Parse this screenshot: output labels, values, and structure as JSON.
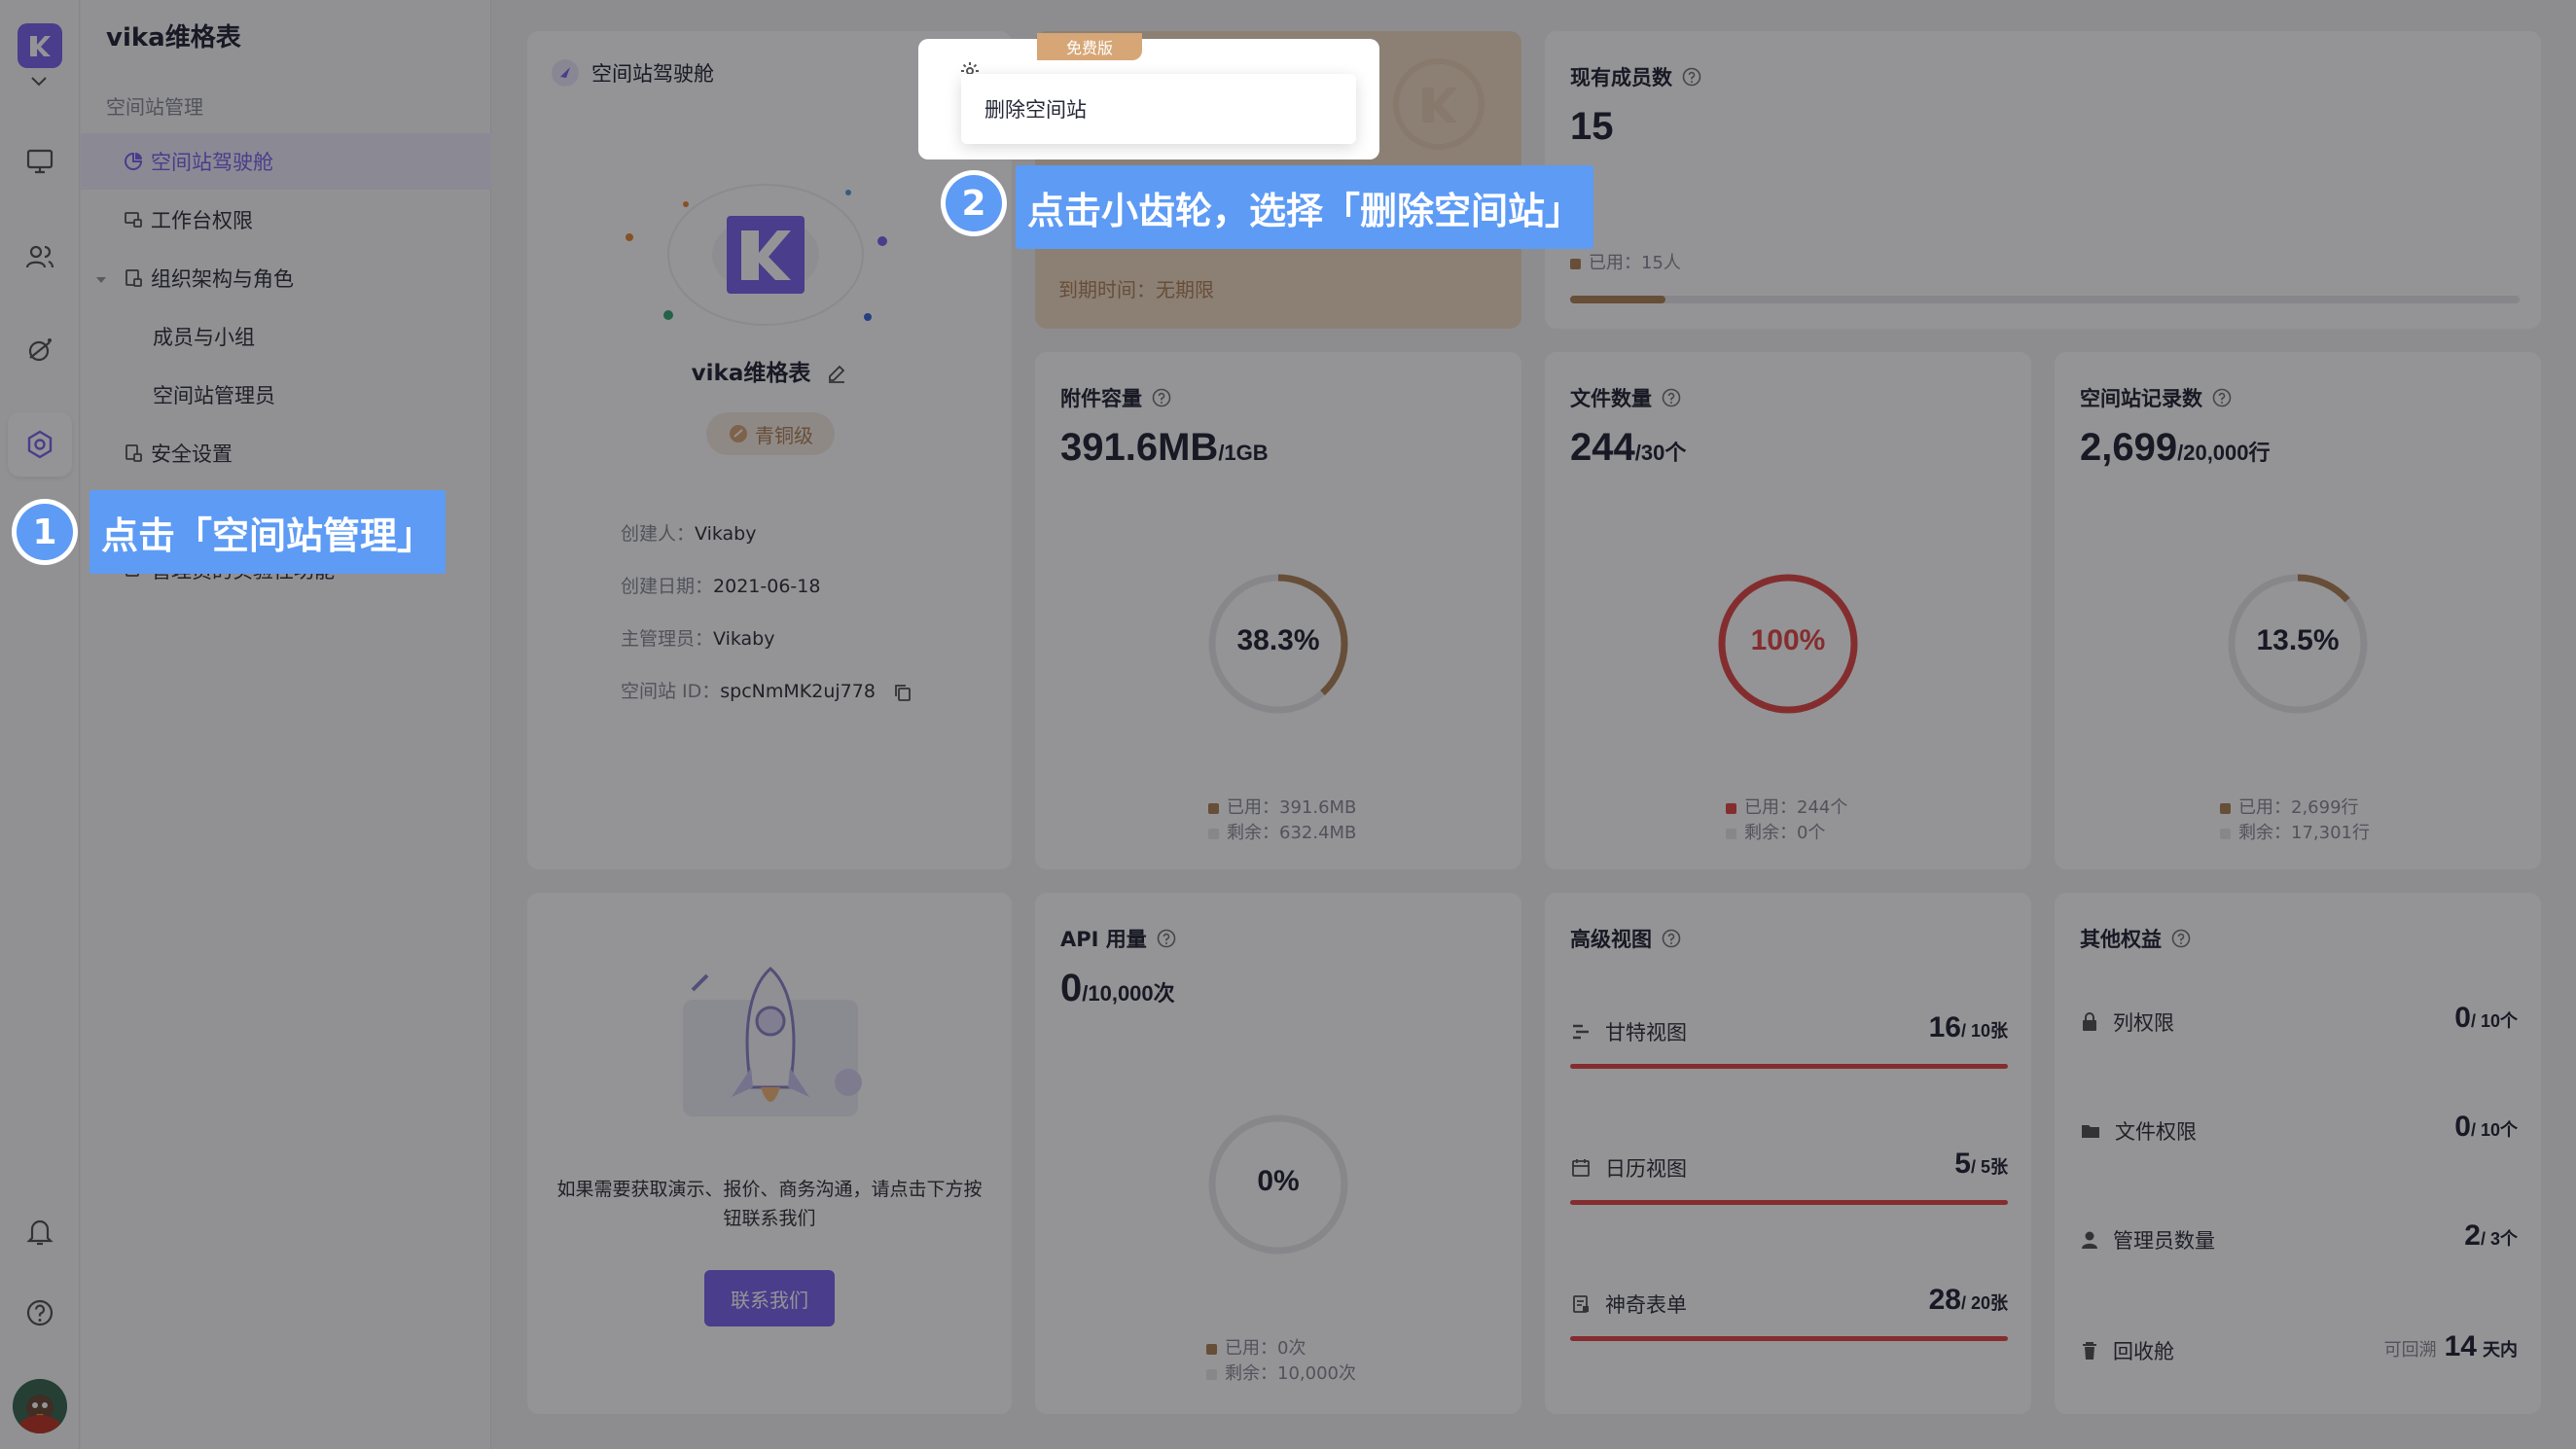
{
  "sidebar": {
    "title": "vika维格表",
    "group_label": "空间站管理",
    "items": [
      {
        "label": "空间站驾驶舱"
      },
      {
        "label": "工作台权限"
      },
      {
        "label": "组织架构与角色"
      },
      {
        "label": "成员与小组"
      },
      {
        "label": "空间站管理员"
      },
      {
        "label": "安全设置"
      },
      {
        "label": "管理员的实验性功能"
      }
    ]
  },
  "cockpit": {
    "title": "空间站驾驶舱",
    "space_name": "vika维格表",
    "level_badge": "青铜级",
    "creator_label": "创建人：",
    "creator": "Vikaby",
    "created_label": "创建日期：",
    "created": "2021-06-18",
    "owner_label": "主管理员：",
    "owner": "Vikaby",
    "id_label": "空间站 ID：",
    "space_id": "spcNmMK2uj778"
  },
  "plan": {
    "badge": "免费版",
    "expiry": "到期时间：无期限"
  },
  "members": {
    "title": "现有成员数",
    "value": "15",
    "used_label": "已用：15人",
    "fraction": 0.1
  },
  "attachments": {
    "title": "附件容量",
    "value": "391.6MB",
    "unit": "/1GB",
    "percent_label": "38.3%",
    "percent": 38.3,
    "used": "已用：391.6MB",
    "remain": "剩余：632.4MB"
  },
  "files": {
    "title": "文件数量",
    "value": "244",
    "unit": "/30个",
    "percent_label": "100%",
    "percent": 100,
    "used": "已用：244个",
    "remain": "剩余：0个"
  },
  "records": {
    "title": "空间站记录数",
    "value": "2,699",
    "unit": "/20,000行",
    "percent_label": "13.5%",
    "percent": 13.5,
    "used": "已用：2,699行",
    "remain": "剩余：17,301行"
  },
  "contact": {
    "text": "如果需要获取演示、报价、商务沟通，请点击下方按钮联系我们",
    "button": "联系我们"
  },
  "api": {
    "title": "API 用量",
    "value": "0",
    "unit": "/10,000次",
    "percent_label": "0%",
    "percent": 0,
    "used": "已用：0次",
    "remain": "剩余：10,000次"
  },
  "advanced_views": {
    "title": "高级视图",
    "rows": [
      {
        "label": "甘特视图",
        "value": "16",
        "limit": "/ 10张"
      },
      {
        "label": "日历视图",
        "value": "5",
        "limit": "/ 5张"
      },
      {
        "label": "神奇表单",
        "value": "28",
        "limit": "/ 20张"
      }
    ]
  },
  "other_benefits": {
    "title": "其他权益",
    "rows": [
      {
        "label": "列权限",
        "value": "0",
        "limit": "/ 10个"
      },
      {
        "label": "文件权限",
        "value": "0",
        "limit": "/ 10个"
      },
      {
        "label": "管理员数量",
        "value": "2",
        "limit": "/ 3个"
      },
      {
        "label": "回收舱",
        "prefix": "可回溯",
        "value": "14",
        "limit": "天内"
      }
    ]
  },
  "popover": {
    "menu_item": "删除空间站"
  },
  "callouts": [
    {
      "number": "1",
      "text": "点击「空间站管理」"
    },
    {
      "number": "2",
      "text": "点击小齿轮，选择「删除空间站」"
    }
  ],
  "colors": {
    "accent": "#7b67ee",
    "callout": "#5d9bf5",
    "ring_attach": "#b0855a",
    "ring_full": "#e34b4b",
    "ring_bg": "#e8e8ec"
  }
}
